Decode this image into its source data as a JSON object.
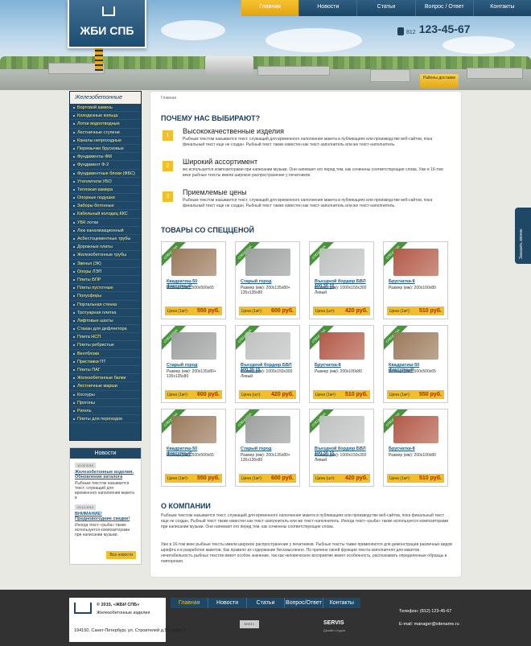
{
  "header": {
    "logo_text": "ЖБИ СПБ",
    "nav": [
      "Главная",
      "Новости",
      "Статьи",
      "Вопрос / Ответ",
      "Контакты"
    ],
    "phone_code": "812",
    "phone_number": "123-45-67",
    "delivery": "Районы доставки"
  },
  "sidebar": {
    "title": "Железобетонные изделия",
    "items": [
      "Бортовой камень",
      "Колодезные кольца",
      "Лотки водоотводные",
      "Лестничные ступени",
      "Каналы непроходные",
      "Перемычки брусковые",
      "Фундаменты ФМ",
      "Фундамент Ф-2",
      "Фундаментные блоки (ФБС)",
      "Утеплители УБО",
      "Теплокая камера",
      "Опорные подушки",
      "Заборы бетонные",
      "Кабельный колодец ККС",
      "УБК лотки",
      "Люк канализационный",
      "Асбестоцементные трубы",
      "Дорожные плиты",
      "Железобетонные трубы",
      "Звенья (ЗК)",
      "Опоры ЛЭП",
      "Плиты БПР",
      "Плиты пустотные",
      "Полусферы",
      "Портальная стенка",
      "Тротуарная плитка",
      "Лифтовые шахты",
      "Стакан для дефлектора",
      "Плита НСП",
      "Плиты ребристые",
      "Вентблоки",
      "Приставки ПТ",
      "Плиты ПАГ",
      "Железобетонные балки",
      "Лестничные марши",
      "Косоуры",
      "Прогоны",
      "Ригель",
      "Плиты для переходов"
    ]
  },
  "news": {
    "title": "Новости",
    "items": [
      {
        "date": "10.02.2015",
        "title": "Железобетонные изделия. Обновление каталога",
        "text": "Рыбным текстом называется текст, служащий для временного наполнения макета в"
      },
      {
        "date": "23.12.2014",
        "title": "ВНИМАНИЕ! Предновогодние скидки!",
        "text": "Иногда текст-«рыба» также используется композиторами при написании музыки."
      }
    ],
    "all": "Все новости"
  },
  "main": {
    "breadcrumb": "Главная",
    "why_title": "ПОЧЕМУ НАС ВЫБИРАЮТ?",
    "features": [
      {
        "num": "1",
        "title": "Высококачественные изделия",
        "text": "Рыбным текстом называется текст, служащий для временного наполнения макета в публикациях или производстве веб-сайтов, пока финальный текст еще не создан. Рыбный текст также известен как текст-заполнитель или же текст-наполнитель."
      },
      {
        "num": "2",
        "title": "Широкий ассортимент",
        "text": "же используется композиторами при написании музыки. Они напевают его перед тем, как сочинены соответствующие слова. Уже в 16-том веке рыбные тексты имели широкое распространение у печатников."
      },
      {
        "num": "3",
        "title": "Приемлемые цены",
        "text": "Рыбным текстом называется текст, служащий для временного наполнения макета в публикациях или производстве веб-сайтов, пока финальный текст еще не создан. Рыбный текст также известен как текст-заполнитель или же текст-наполнитель."
      }
    ],
    "products_title": "ТОВАРЫ СО СПЕЦЦЕНОЙ",
    "ribbon": "СПЕЦЦЕНА",
    "products": [
      {
        "name": "Квадратиш-50 фактурный",
        "size": "Размер (мм): 500х500х65",
        "price_label": "Цена (1м²):",
        "price": "550 руб.",
        "color": "#9b7a5c"
      },
      {
        "name": "Старый город",
        "size": "Размер (мм): 200х135х80+ 135х135х80",
        "price_label": "Цена (1м²):",
        "price": "600 руб.",
        "color": "#9da09f"
      },
      {
        "name": "Въездной бордюр БВЛ 100.30.15",
        "size": "Размер (мм): 1000х150х300 Левый",
        "price_label": "Цена (шт):",
        "price": "420 руб.",
        "color": "#bfc2c0"
      },
      {
        "name": "Брусчатка-8",
        "size": "Размер (мм): 200х100х80",
        "price_label": "Цена (1м²):",
        "price": "510 руб.",
        "color": "#b35a48"
      },
      {
        "name": "Старый город",
        "size": "Размер (мм): 200х135х80+ 135х135х80",
        "price_label": "Цена (1м²):",
        "price": "600 руб.",
        "color": "#9da09f"
      },
      {
        "name": "Въездной бордюр БВЛ 100.30.15",
        "size": "Размер (мм): 1000х150х300 Левый",
        "price_label": "Цена (шт):",
        "price": "420 руб.",
        "color": "#bfc2c0"
      },
      {
        "name": "Брусчатка-8",
        "size": "Размер (мм): 200х100х80",
        "price_label": "Цена (1м²):",
        "price": "510 руб.",
        "color": "#b35a48"
      },
      {
        "name": "Квадратиш-50 фактурный",
        "size": "Размер (мм): 500х500х65",
        "price_label": "Цена (1м²):",
        "price": "550 руб.",
        "color": "#9b7a5c"
      },
      {
        "name": "Квадратиш-50 фактурный",
        "size": "Размер (мм): 500х500х65",
        "price_label": "Цена (1м²):",
        "price": "550 руб.",
        "color": "#9b7a5c"
      },
      {
        "name": "Старый город",
        "size": "Размер (мм): 200х135х80+ 135х135х80",
        "price_label": "Цена (1м²):",
        "price": "600 руб.",
        "color": "#9da09f"
      },
      {
        "name": "Въездной бордюр БВЛ 100.30.15",
        "size": "Размер (мм): 1000х150х300 Левый",
        "price_label": "Цена (шт):",
        "price": "420 руб.",
        "color": "#bfc2c0"
      },
      {
        "name": "Брусчатка-8",
        "size": "Размер (мм): 200х100х80",
        "price_label": "Цена (1м²):",
        "price": "510 руб.",
        "color": "#b35a48"
      }
    ],
    "about_title": "О КОМПАНИИ",
    "about_p1": "Рыбным текстом называется текст, служащий для временного наполнения макета в публикациях или производстве веб-сайтов, пока финальный текст еще не создан. Рыбный текст также известен как текст-заполнитель или же текст-наполнитель. Иногда текст-«рыба» также используется композиторами при написании музыки. Они напевают его перед тем, как сочинены соответствующие слова.",
    "about_p2": "Уже в 16-том веке рыбные тексты имели широкое распространение у печатников. Рыбные тексты также применяются для демонстрации различных видов шрифта и в разработке макетов. Как правило их содержание бессмысленно. По причине своей функции текста-заполнителя для макетов нечитабельность рыбных текстов имеет особое значение, так как человеческое восприятие имеет особенность, распознавать определенные образцы и повторения."
  },
  "callback": "Заказать звонок",
  "footer": {
    "copyright": "© 2015, «ЖБИ СПБ»",
    "subtitle": "Железобетонные изделия",
    "address": "194150, Санкт-Петербург, ул. Строителей д.59, корп. 7",
    "nav": [
      "Главная",
      "Новости",
      "Статьи",
      "Вопрос/Ответ",
      "Контакты"
    ],
    "phone": "Телефон: (812) 123-45-67",
    "email": "E-mail: manager@sitename.ru",
    "counter": "ВВЕЕ1",
    "dev": "SERVIS",
    "dev_sub": "Дизайн студия"
  }
}
